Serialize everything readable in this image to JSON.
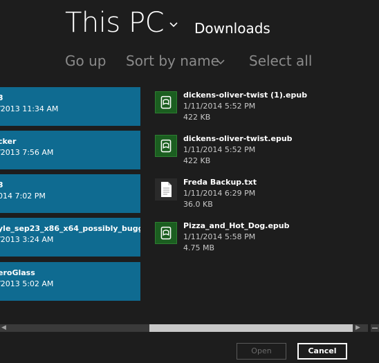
{
  "header": {
    "location": "This PC",
    "folder": "Downloads"
  },
  "commands": {
    "go_up": "Go up",
    "sort": "Sort by name",
    "select_all": "Select all"
  },
  "selected_tiles": [
    {
      "name": "3",
      "date": "/2013 11:34 AM"
    },
    {
      "name": "cker",
      "date": "/2013 7:56 AM"
    },
    {
      "name": "3",
      "date": "014 7:02 PM"
    },
    {
      "name": "yle_sep23_x86_x64_possibly_bugge...",
      "date": "/2013 3:24 AM"
    },
    {
      "name": "eroGlass",
      "date": "/2013 5:02 AM"
    }
  ],
  "files": [
    {
      "name": "dickens-oliver-twist (1).epub",
      "date": "1/11/2014 5:52 PM",
      "size": "422 KB",
      "icon": "epub-book-icon"
    },
    {
      "name": "dickens-oliver-twist.epub",
      "date": "1/11/2014 5:52 PM",
      "size": "422 KB",
      "icon": "epub-book-icon"
    },
    {
      "name": "Freda Backup.txt",
      "date": "1/11/2014 6:29 PM",
      "size": "36.0 KB",
      "icon": "text-file-icon"
    },
    {
      "name": "Pizza_and_Hot_Dog.epub",
      "date": "1/11/2014 5:58 PM",
      "size": "4.75 MB",
      "icon": "epub-book-icon"
    }
  ],
  "buttons": {
    "open": "Open",
    "cancel": "Cancel"
  },
  "colors": {
    "background": "#1d1d1d",
    "tile_selected": "#0f6b91",
    "epub_icon": "#1b5e20"
  }
}
